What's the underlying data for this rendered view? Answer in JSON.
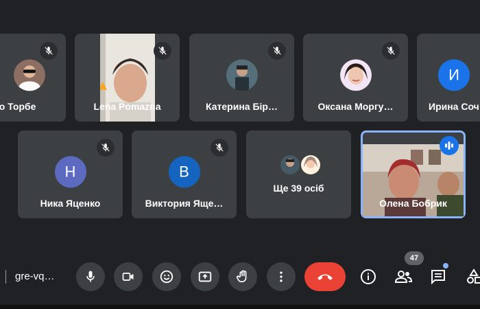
{
  "participants_row1": [
    {
      "name": "ло Торбе",
      "type": "photo"
    },
    {
      "name": "Lena Pomazna",
      "type": "video"
    },
    {
      "name": "Катерина Бір…",
      "type": "photo"
    },
    {
      "name": "Оксана Моргу…",
      "type": "photo"
    },
    {
      "name": "Ирина Соч",
      "type": "letter",
      "letter": "И",
      "color": "#1a73e8"
    }
  ],
  "participants_row2": [
    {
      "name": "Ника Яценко",
      "type": "letter",
      "letter": "Н",
      "color": "#5c6bc0"
    },
    {
      "name": "Виктория Яще…",
      "type": "letter",
      "letter": "В",
      "color": "#1565c0"
    },
    {
      "name": "Ще 39 осіб",
      "type": "others"
    },
    {
      "name": "Олена Бобрик",
      "type": "video",
      "speaking": true
    }
  ],
  "toolbar": {
    "meeting_code": "gre-vq…",
    "participant_count": "47"
  },
  "colors": {
    "background": "#202124",
    "tile": "#3c4043",
    "end_call": "#ea4335",
    "speaking_border": "#8ab4f8"
  },
  "icons": [
    "mic-icon",
    "camera-icon",
    "emoji-icon",
    "present-icon",
    "raise-hand-icon",
    "more-options-icon",
    "end-call-icon",
    "info-icon",
    "people-icon",
    "chat-icon",
    "activities-icon"
  ]
}
